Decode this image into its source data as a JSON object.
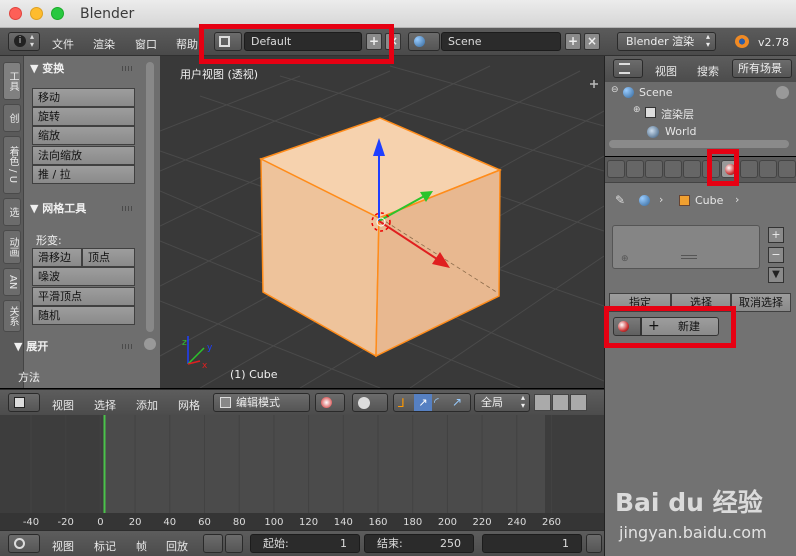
{
  "window": {
    "title": "Blender"
  },
  "infobar": {
    "menus": [
      "文件",
      "渲染",
      "窗口",
      "帮助"
    ],
    "screen_layout": "Default",
    "scene": "Scene",
    "render_engine": "Blender 渲染",
    "version": "v2.78"
  },
  "toolshelf": {
    "tabs": [
      "工具",
      "创",
      "着色 / U",
      "选",
      "动画",
      "AN",
      "关系"
    ],
    "transform_header": "▼ 变换",
    "transform_buttons": [
      "移动",
      "旋转",
      "缩放",
      "法向缩放",
      "推 / 拉"
    ],
    "mesh_tools_header": "▼ 网格工具",
    "deform_label": "形变:",
    "deform_row": [
      "滑移边",
      "顶点"
    ],
    "deform_buttons": [
      "噪波",
      "平滑顶点",
      "随机"
    ],
    "unwrap_header": "▼ 展开",
    "method_label": "方法"
  },
  "viewport": {
    "title": "用户视图 (透视)",
    "object_label": "(1) Cube",
    "axis_x": "x",
    "axis_y": "y",
    "axis_z": "z"
  },
  "viewport_header": {
    "menus": [
      "视图",
      "选择",
      "添加",
      "网格"
    ],
    "mode": "编辑模式",
    "pivot_global": "全局"
  },
  "timeline": {
    "ruler": [
      "-40",
      "-20",
      "0",
      "20",
      "40",
      "60",
      "80",
      "100",
      "120",
      "140",
      "160",
      "180",
      "200",
      "220",
      "240",
      "260"
    ],
    "current_frame_marker": 0,
    "menus": [
      "视图",
      "标记",
      "帧",
      "回放"
    ],
    "start_label": "起始:",
    "start_value": "1",
    "end_label": "结束:",
    "end_value": "250",
    "current_value": "1"
  },
  "outliner": {
    "menus": [
      "视图",
      "搜索"
    ],
    "filter": "所有场景",
    "items": [
      "Scene",
      "渲染层",
      "World"
    ]
  },
  "properties": {
    "breadcrumb_object": "Cube",
    "material_buttons": [
      "指定",
      "选择",
      "取消选择"
    ],
    "new_button": "新建"
  },
  "watermark": {
    "logo": "Bai du 经验",
    "url": "jingyan.baidu.com"
  },
  "colors": {
    "highlight_red": "#e60012",
    "cube_face": "#f0c39b",
    "selection_orange": "#ff8c1a"
  }
}
